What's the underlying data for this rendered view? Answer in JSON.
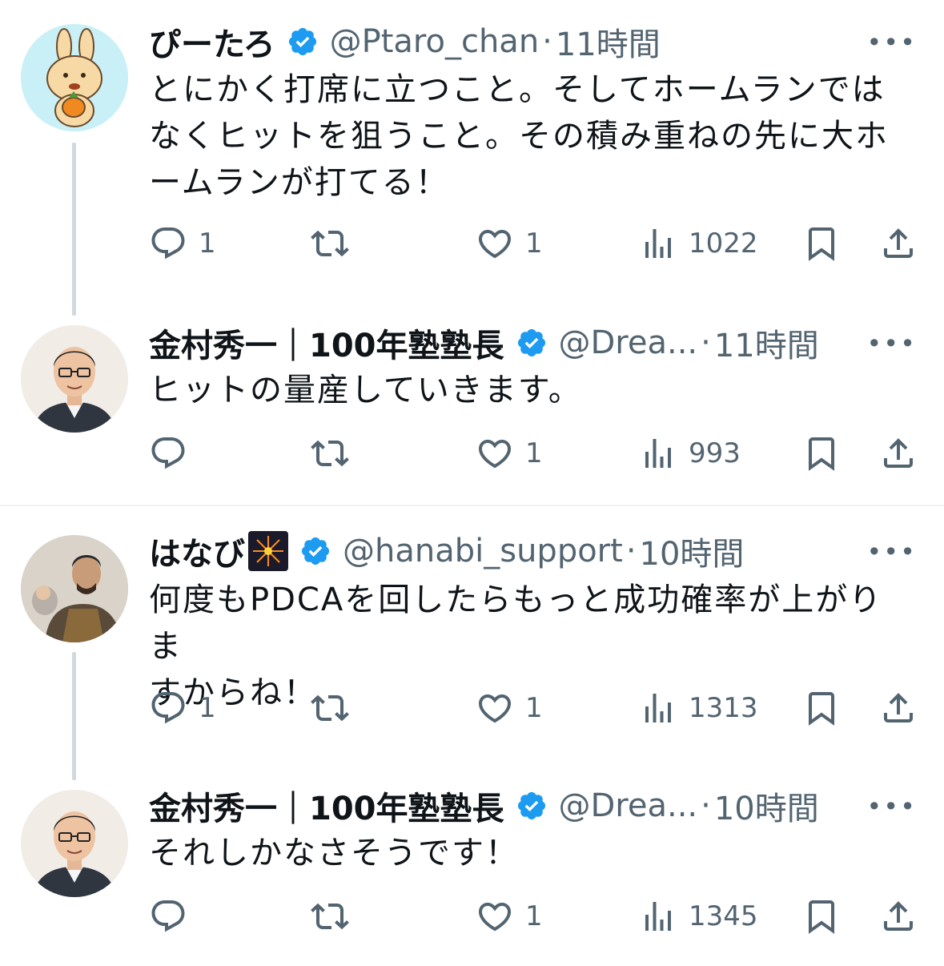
{
  "colors": {
    "text": "#0f1419",
    "secondary": "#536471",
    "verified": "#1d9bf0",
    "thread_line": "#cfd9de"
  },
  "tweets": [
    {
      "name": "ぴーたろ",
      "handle": "@Ptaro_chan",
      "time": "11時間",
      "text": "とにかく打席に立つこと。そしてホームランでは\nなくヒットを狙うこと。その積み重ねの先に大ホ\nームランが打てる！",
      "reply_count": "1",
      "retweet_count": "",
      "like_count": "1",
      "view_count": "1022",
      "avatar_icon": "rabbit-avatar-icon"
    },
    {
      "name": "金村秀一｜100年塾塾長",
      "handle": "@Drea...",
      "time": "11時間",
      "text": "ヒットの量産していきます。",
      "reply_count": "",
      "retweet_count": "",
      "like_count": "1",
      "view_count": "993",
      "avatar_icon": "man-glasses-avatar-icon"
    },
    {
      "name": "はなび",
      "handle": "@hanabi_support",
      "time": "10時間",
      "text": "何度もPDCAを回したらもっと成功確率が上がりま\nすからね！",
      "reply_count": "1",
      "retweet_count": "",
      "like_count": "1",
      "view_count": "1313",
      "avatar_icon": "samurai-avatar-icon",
      "name_emoji": "fireworks-icon"
    },
    {
      "name": "金村秀一｜100年塾塾長",
      "handle": "@Drea...",
      "time": "10時間",
      "text": "それしかなさそうです！",
      "reply_count": "",
      "retweet_count": "",
      "like_count": "1",
      "view_count": "1345",
      "avatar_icon": "man-glasses-avatar-icon"
    }
  ]
}
